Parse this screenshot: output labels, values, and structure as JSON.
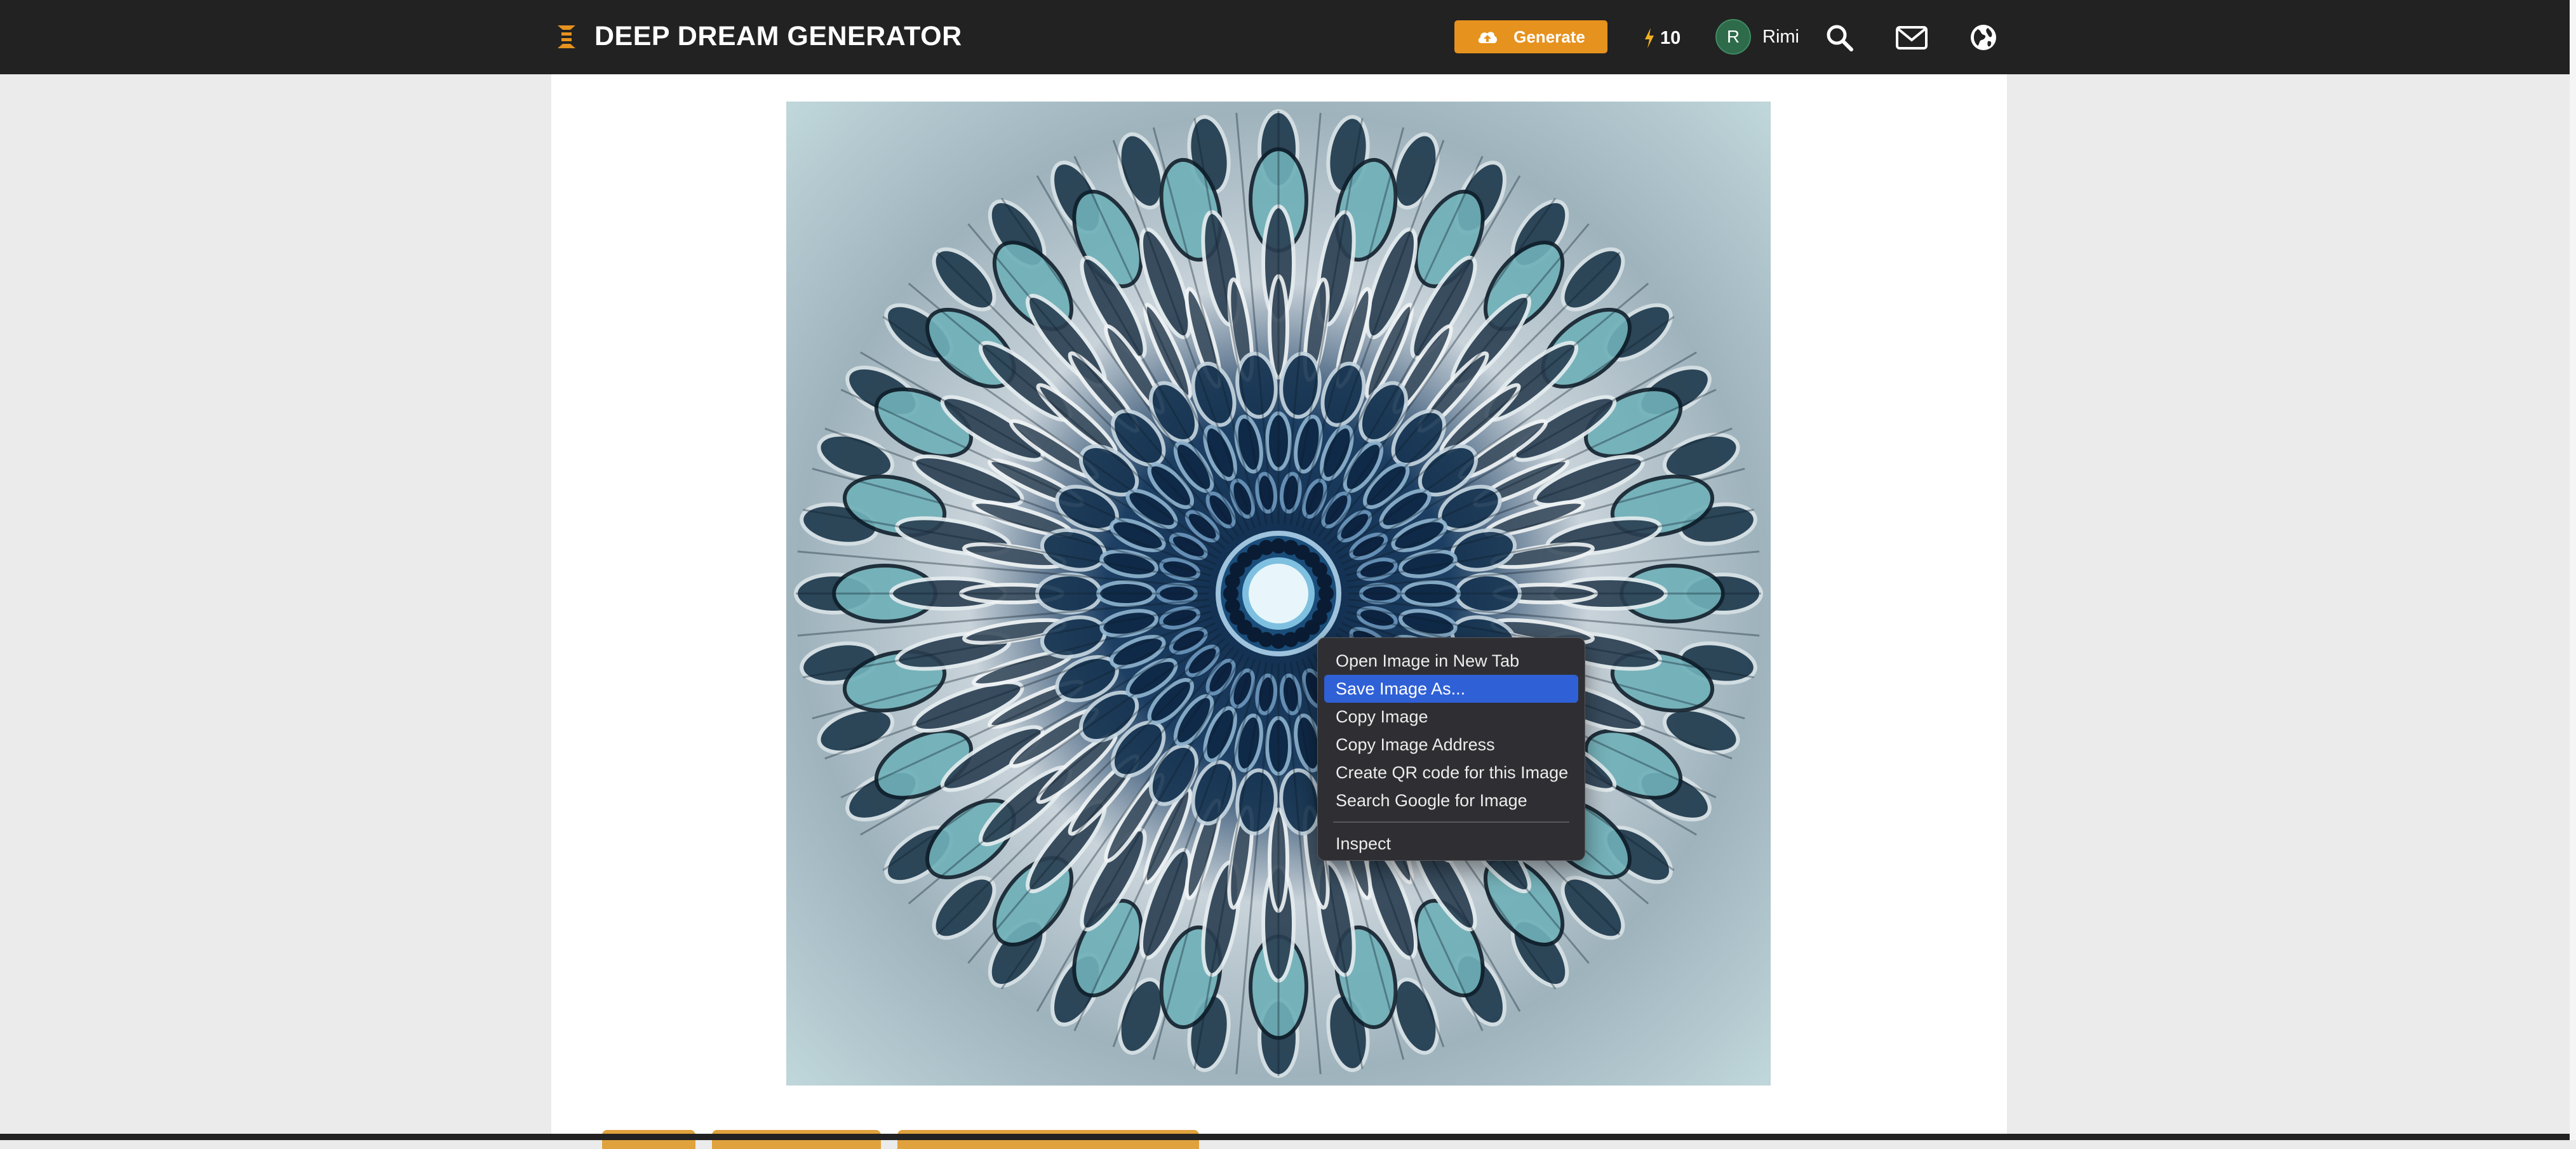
{
  "topbar": {
    "brand": "DEEP DREAM GENERATOR",
    "generate_label": "Generate",
    "energy_count": "10",
    "avatar_initial": "R",
    "username": "Rimi",
    "icons": [
      "menu-icon",
      "cloud-upload-icon",
      "bolt-icon",
      "search-icon",
      "mail-icon",
      "globe-icon"
    ]
  },
  "context_menu": {
    "items": [
      {
        "label": "Open Image in New Tab"
      },
      {
        "label": "Save Image As..."
      },
      {
        "label": "Copy Image"
      },
      {
        "label": "Copy Image Address"
      },
      {
        "label": "Create QR code for this Image"
      },
      {
        "label": "Search Google for Image"
      },
      {
        "label": "Inspect"
      }
    ],
    "highlighted": "Save Image As..."
  },
  "colors": {
    "topbar": "#222222",
    "accent": "#e6921e",
    "menu_bg": "#2f2f33",
    "menu_highlight": "#2f60d6"
  }
}
